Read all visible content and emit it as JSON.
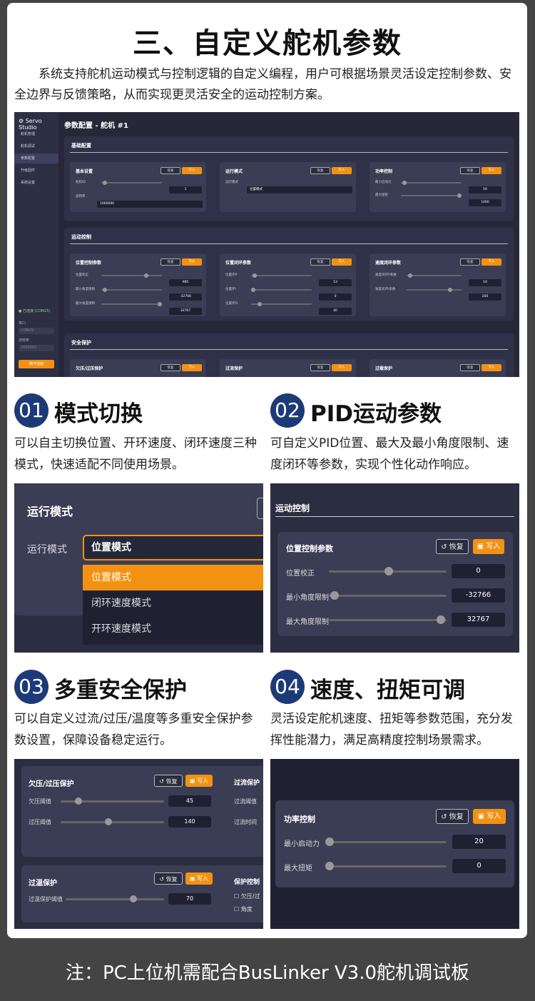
{
  "page": {
    "title": "三、自定义舵机参数",
    "intro": "系统支持舵机运动模式与控制逻辑的自定义编程，用户可根据场景灵活设定控制参数、安全边界与反馈策略，从而实现更灵活安全的运动控制方案。",
    "note": "注：PC上位机需配合BusLinker V3.0舵机调试板"
  },
  "app": {
    "logo": "Servo Studio",
    "nav": [
      "舵机管理",
      "舵机调试",
      "参数配置",
      "升级固件",
      "系统设置"
    ],
    "status": "已连接 (COM25)",
    "port_label": "串口",
    "port_value": "COM25",
    "baud_label": "波特率",
    "baud_value": "1000000",
    "disconnect": "断开连接",
    "main_title": "参数配置 - 舵机 #1",
    "restore": "恢复",
    "write": "写入",
    "sections": {
      "basic": "基础配置",
      "motion": "运动控制",
      "safety": "安全保护"
    },
    "basic": {
      "p1_title": "基本设置",
      "id_label": "舵机ID",
      "id_value": "1",
      "baud_label": "波特率",
      "baud_value": "1000000",
      "p2_title": "运行模式",
      "mode_label": "运行模式",
      "mode_value": "位置模式",
      "p3_title": "功率控制",
      "minp_label": "最小启动力",
      "minp_value": "16",
      "maxt_label": "最大扭矩",
      "maxt_value": "1000"
    },
    "motion": {
      "p1_title": "位置控制参数",
      "pos_cal": "位置校正",
      "pos_cal_v": "985",
      "min_ang": "最小角度限制",
      "min_ang_v": "-32766",
      "max_ang": "最大角度限制",
      "max_ang_v": "32767",
      "p2_title": "位置闭环参数",
      "kp": "位置环P",
      "kp_v": "13",
      "ki": "位置环I",
      "ki_v": "0",
      "kd": "位置环D",
      "kd_v": "40",
      "p3_title": "速度闭环参数",
      "vp": "速度闭环P系数",
      "vp_v": "10",
      "vi": "速度闭环I系数",
      "vi_v": "200"
    },
    "safety": {
      "p1": "欠压/过压保护",
      "p2": "过流保护",
      "p3": "过载保护"
    }
  },
  "features": [
    {
      "num": "01",
      "title": "模式切换",
      "desc": "可以自主切换位置、开环速度、闭环速度三种模式，快速适配不同使用场景。"
    },
    {
      "num": "02",
      "title": "PID运动参数",
      "desc": "可自定义PID位置、最大及最小角度限制、速度闭环等参数，实现个性化动作响应。"
    },
    {
      "num": "03",
      "title": "多重安全保护",
      "desc": "可以自定义过流/过压/温度等多重安全保护参数设置，保障设备稳定运行。"
    },
    {
      "num": "04",
      "title": "速度、扭矩可调",
      "desc": "灵活设定舵机速度、扭矩等参数范围，充分发挥性能潜力，满足高精度控制场景需求。"
    }
  ],
  "crop1": {
    "title": "运行模式",
    "label": "运行模式",
    "value": "位置模式",
    "options": [
      "位置模式",
      "闭环速度模式",
      "开环速度模式"
    ]
  },
  "crop2": {
    "section": "运动控制",
    "title": "位置控制参数",
    "restore": "恢复",
    "write": "写入",
    "rows": [
      {
        "label": "位置校正",
        "value": "0"
      },
      {
        "label": "最小角度限制",
        "value": "-32766"
      },
      {
        "label": "最大角度限制",
        "value": "32767"
      }
    ]
  },
  "crop3": {
    "p1_title": "欠压/过压保护",
    "restore": "恢复",
    "write": "写入",
    "uv_label": "欠压阈值",
    "uv_value": "45",
    "ov_label": "过压阈值",
    "ov_value": "140",
    "p2_title": "过流保护",
    "oc_label": "过流阈值",
    "oc_time": "过流时间",
    "p3_title": "过温保护",
    "ot_label": "过温保护阈值",
    "ot_value": "70",
    "p4_title": "保护控制",
    "cb1": "欠压/过",
    "cb2": "角度"
  },
  "crop4": {
    "title": "功率控制",
    "restore": "恢复",
    "write": "写入",
    "minp_label": "最小启动力",
    "minp_value": "20",
    "maxt_label": "最大扭矩",
    "maxt_value": "0"
  }
}
